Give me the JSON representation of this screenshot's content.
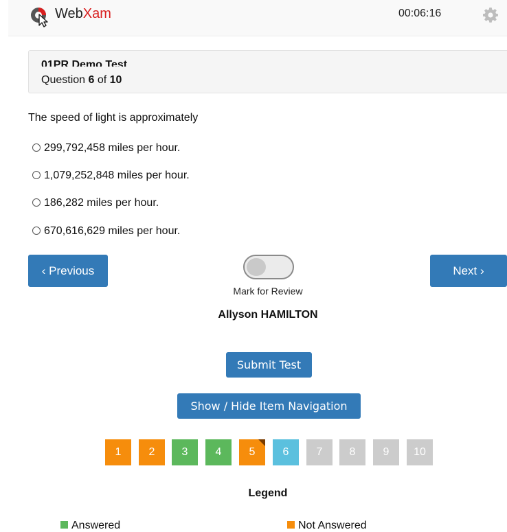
{
  "header": {
    "logo_text_a": "Web",
    "logo_text_b": "Xam",
    "timer": "00:06:16",
    "settings_icon": "gear-icon"
  },
  "test": {
    "title": "01PR Demo Test",
    "question_prefix": "Question",
    "question_current": "6",
    "question_of": "of",
    "question_total": "10"
  },
  "question": {
    "text": "The speed of light is approximately",
    "options": [
      "299,792,458 miles per hour.",
      "1,079,252,848 miles per hour.",
      "186,282 miles per hour.",
      "670,616,629 miles per hour."
    ]
  },
  "controls": {
    "previous_label": "‹ Previous",
    "next_label": "Next ›",
    "mark_for_review_label": "Mark for Review",
    "mark_for_review_on": false,
    "candidate_name": "Allyson HAMILTON",
    "submit_label": "Submit Test",
    "nav_toggle_label": "Show / Hide Item Navigation"
  },
  "navigation": {
    "items": [
      {
        "label": "1",
        "status": "not-answered"
      },
      {
        "label": "2",
        "status": "not-answered"
      },
      {
        "label": "3",
        "status": "answered"
      },
      {
        "label": "4",
        "status": "answered"
      },
      {
        "label": "5",
        "status": "not-answered",
        "flagged": true
      },
      {
        "label": "6",
        "status": "current"
      },
      {
        "label": "7",
        "status": "not-visited"
      },
      {
        "label": "8",
        "status": "not-visited"
      },
      {
        "label": "9",
        "status": "not-visited"
      },
      {
        "label": "10",
        "status": "not-visited"
      }
    ]
  },
  "legend": {
    "title": "Legend",
    "answered_label": "Answered",
    "not_answered_label": "Not Answered"
  },
  "colors": {
    "primary_button": "#337ab7",
    "answered": "#5cb85c",
    "not_answered": "#f68d0c",
    "current": "#5bc0de",
    "not_visited": "#cccccc",
    "brand_red": "#d81e1e"
  }
}
